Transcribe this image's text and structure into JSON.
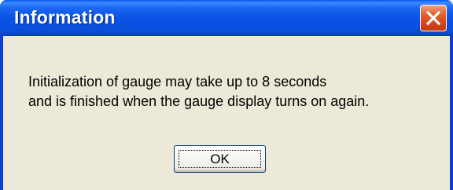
{
  "dialog": {
    "title": "Information",
    "message_lines": [
      "Initialization of gauge may take up to 8 seconds",
      "and is finished when the gauge display turns on again."
    ],
    "ok_label": "OK"
  },
  "icons": {
    "close": "close-icon"
  },
  "colors": {
    "titlebar": "#0a55e5",
    "client_background": "#ece9d8",
    "close_button": "#d64516"
  }
}
